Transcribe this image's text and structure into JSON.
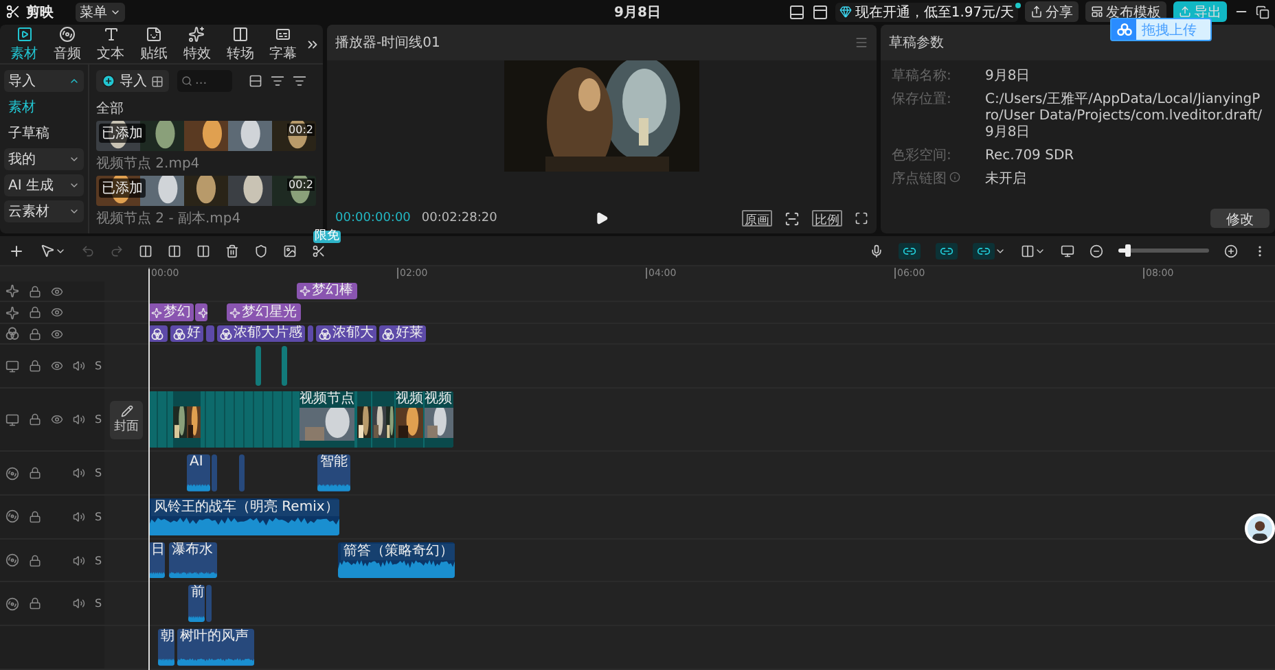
{
  "top_bar": {
    "app_name": "剪映",
    "menu": "菜单",
    "title": "9月8日",
    "promo": "现在开通，低至1.97元/天",
    "share": "分享",
    "publish_template": "发布模板",
    "export": "导出",
    "upload_tip": "拖拽上传"
  },
  "media_panel": {
    "tabs": [
      {
        "kind": "media",
        "label": "素材",
        "selected": true
      },
      {
        "kind": "audio",
        "label": "音频",
        "selected": false
      },
      {
        "kind": "text",
        "label": "文本",
        "selected": false
      },
      {
        "kind": "sticker",
        "label": "贴纸",
        "selected": false
      },
      {
        "kind": "effect",
        "label": "特效",
        "selected": false
      },
      {
        "kind": "transition",
        "label": "转场",
        "selected": false
      },
      {
        "kind": "caption",
        "label": "字幕",
        "selected": false
      }
    ],
    "sidebar": [
      {
        "kind": "group",
        "label": "导入",
        "expanded": true
      },
      {
        "kind": "item",
        "label": "素材",
        "selected": true
      },
      {
        "kind": "item",
        "label": "子草稿",
        "selected": false
      },
      {
        "kind": "group",
        "label": "我的",
        "expanded": false
      },
      {
        "kind": "group",
        "label": "AI 生成",
        "expanded": false
      },
      {
        "kind": "group",
        "label": "云素材",
        "expanded": false
      }
    ],
    "import_button": "导入",
    "search": {
      "placeholder": "..."
    },
    "section": "全部",
    "items": [
      {
        "name": "视频节点 2.mp4",
        "badge": "已添加",
        "duration": "00:2"
      },
      {
        "name": "视频节点 2 - 副本.mp4",
        "badge": "已添加",
        "duration": "00:2"
      }
    ]
  },
  "player": {
    "title": "播放器-时间线01",
    "current_time": "00:00:00:00",
    "total_time": "00:02:28:20",
    "buttons": [
      "原画",
      "比例"
    ]
  },
  "draft": {
    "title": "草稿参数",
    "rows": [
      {
        "label": "草稿名称:",
        "value": "9月8日"
      },
      {
        "label": "保存位置:",
        "value": "C:/Users/王雅平/AppData/Local/JianyingPro/User Data/Projects/com.lveditor.draft/9月8日"
      },
      {
        "label": "色彩空间:",
        "value": "Rec.709 SDR"
      },
      {
        "label": "序点链图",
        "value": "未开启",
        "info": true
      }
    ],
    "button": "修改"
  },
  "toolbar": {
    "badge": "限免",
    "zoom": {
      "level": 0.1
    }
  },
  "timeline": {
    "ruler": [
      "00:00",
      "02:00",
      "04:00",
      "06:00",
      "08:00"
    ],
    "cover": "封面",
    "tracks": [
      {
        "kind": "effect",
        "clips": [
          {
            "kind": "effect",
            "label": "梦幻棒"
          }
        ]
      },
      {
        "kind": "effect",
        "clips": [
          {
            "kind": "effect",
            "label": "梦幻"
          },
          {
            "kind": "effect"
          },
          {
            "kind": "effect",
            "label": "梦幻星光"
          }
        ]
      },
      {
        "kind": "filter",
        "clips": [
          {
            "kind": "filter"
          },
          {
            "kind": "filter",
            "label": "好"
          },
          {
            "kind": "filter"
          },
          {
            "kind": "filter",
            "label": "浓郁大片感"
          },
          {
            "kind": "filter"
          },
          {
            "kind": "filter",
            "label": "浓郁大"
          },
          {
            "kind": "filter",
            "label": "好莱"
          }
        ]
      },
      {
        "kind": "video",
        "solo": "S",
        "clips": [
          {
            "kind": "video"
          },
          {
            "kind": "video"
          }
        ]
      },
      {
        "kind": "main",
        "solo": "S",
        "clips": [
          {
            "kind": "main",
            "segments": [
              {
                "kind": "thumb"
              },
              {
                "kind": "thumb"
              },
              {
                "kind": "thumb",
                "label": "视频节点"
              },
              {
                "kind": "thumb"
              },
              {
                "kind": "thumb"
              },
              {
                "kind": "thumb"
              },
              {
                "kind": "thumb",
                "label": "视频"
              },
              {
                "kind": "thumb",
                "label": "视频"
              }
            ]
          }
        ]
      },
      {
        "kind": "audio",
        "solo": "S",
        "clips": [
          {
            "kind": "sound",
            "label": "AI"
          },
          {
            "kind": "sound"
          },
          {
            "kind": "sound"
          },
          {
            "kind": "sound",
            "label": "智能"
          }
        ]
      },
      {
        "kind": "audio",
        "solo": "S",
        "clips": [
          {
            "kind": "music",
            "label": "风铃王的战车（明亮 Remix）"
          }
        ]
      },
      {
        "kind": "audio",
        "solo": "S",
        "clips": [
          {
            "kind": "sound",
            "label": "日"
          },
          {
            "kind": "sound",
            "label": "瀑布水"
          },
          {
            "kind": "music",
            "label": "箭答（策略奇幻）"
          }
        ]
      },
      {
        "kind": "audio",
        "solo": "S",
        "clips": [
          {
            "kind": "sound",
            "label": "前"
          },
          {
            "kind": "sound"
          }
        ]
      },
      {
        "kind": "audio",
        "header": false,
        "clips": [
          {
            "kind": "sound",
            "label": "朝"
          },
          {
            "kind": "sound",
            "label": "树叶的风声"
          }
        ]
      }
    ]
  }
}
